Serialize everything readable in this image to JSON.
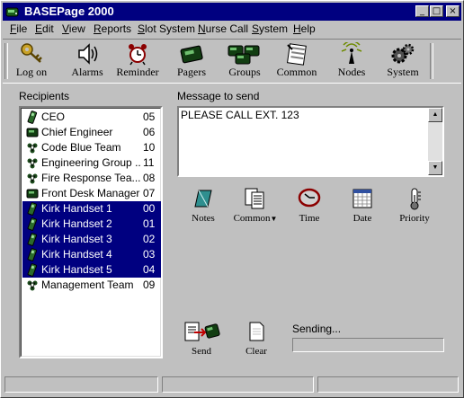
{
  "window": {
    "title": "BASEPage 2000"
  },
  "title_buttons": {
    "minimize": "_",
    "maximize": "□",
    "close": "×"
  },
  "menu": [
    {
      "label": "File",
      "u": "F",
      "rest": "ile"
    },
    {
      "label": "Edit",
      "u": "E",
      "rest": "dit"
    },
    {
      "label": "View",
      "u": "V",
      "rest": "iew"
    },
    {
      "label": "Reports",
      "u": "R",
      "rest": "eports"
    },
    {
      "label": "Slot System",
      "u": "S",
      "rest": "lot System"
    },
    {
      "label": "Nurse Call",
      "u": "N",
      "rest": "urse Call"
    },
    {
      "label": "System",
      "u": "S",
      "rest": "ystem"
    },
    {
      "label": "Help",
      "u": "H",
      "rest": "elp"
    }
  ],
  "toolbar": [
    {
      "label": "Log on",
      "icon": "key-icon"
    },
    {
      "label": "Alarms",
      "icon": "speaker-icon"
    },
    {
      "label": "Reminder",
      "icon": "alarm-clock-icon"
    },
    {
      "label": "Pagers",
      "icon": "pager-icon"
    },
    {
      "label": "Groups",
      "icon": "pager-group-icon"
    },
    {
      "label": "Common",
      "icon": "common-messages-icon"
    },
    {
      "label": "Nodes",
      "icon": "network-node-icon"
    },
    {
      "label": "System",
      "icon": "gears-icon"
    }
  ],
  "recipients": {
    "label": "Recipients",
    "items": [
      {
        "name": "CEO",
        "code": "05",
        "type": "handset",
        "selected": false
      },
      {
        "name": "Chief Engineer",
        "code": "06",
        "type": "pager",
        "selected": false
      },
      {
        "name": "Code Blue Team",
        "code": "10",
        "type": "group",
        "selected": false
      },
      {
        "name": "Engineering Group ...",
        "code": "11",
        "type": "group",
        "selected": false
      },
      {
        "name": "Fire Response Tea...",
        "code": "08",
        "type": "group",
        "selected": false
      },
      {
        "name": "Front Desk Manager",
        "code": "07",
        "type": "pager",
        "selected": false
      },
      {
        "name": "Kirk Handset 1",
        "code": "00",
        "type": "handset",
        "selected": true
      },
      {
        "name": "Kirk Handset 2",
        "code": "01",
        "type": "handset",
        "selected": true
      },
      {
        "name": "Kirk Handset 3",
        "code": "02",
        "type": "handset",
        "selected": true
      },
      {
        "name": "Kirk Handset 4",
        "code": "03",
        "type": "handset",
        "selected": true
      },
      {
        "name": "Kirk Handset 5",
        "code": "04",
        "type": "handset",
        "selected": true
      },
      {
        "name": "Management Team",
        "code": "09",
        "type": "group",
        "selected": false
      }
    ]
  },
  "message": {
    "label": "Message to send",
    "text": "PLEASE CALL EXT. 123"
  },
  "message_tools": [
    {
      "label": "Notes",
      "icon": "notepad-icon"
    },
    {
      "label": "Common",
      "icon": "common-list-icon"
    },
    {
      "label": "Time",
      "icon": "clock-icon"
    },
    {
      "label": "Date",
      "icon": "calendar-icon"
    },
    {
      "label": "Priority",
      "icon": "thermometer-icon"
    }
  ],
  "actions": {
    "send": "Send",
    "clear": "Clear"
  },
  "sending": {
    "label": "Sending...",
    "progress": 0
  },
  "colors": {
    "face": "#c0c0c0",
    "title": "#000080",
    "selection": "#000080"
  }
}
